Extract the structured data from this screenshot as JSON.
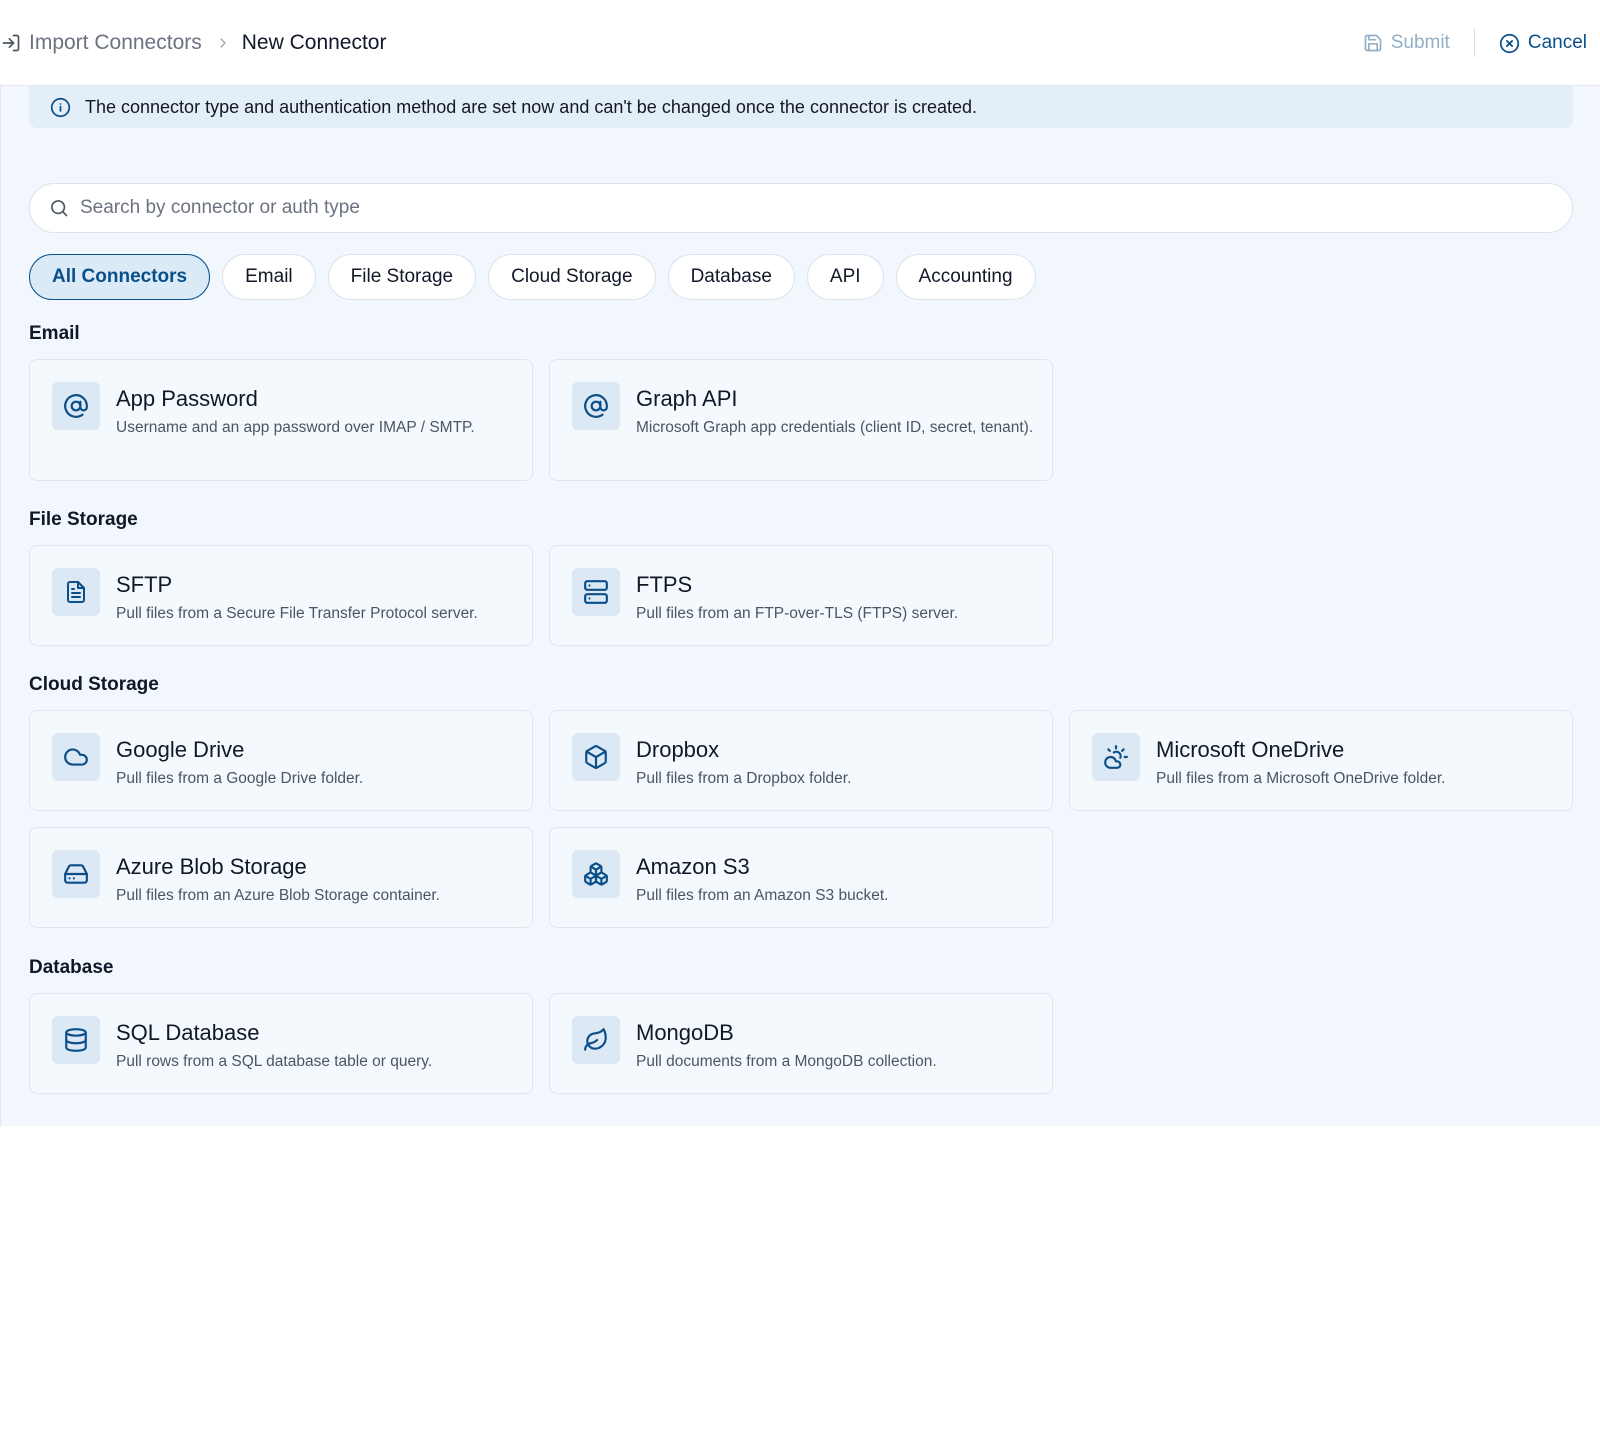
{
  "header": {
    "breadcrumb_parent": "Import Connectors",
    "breadcrumb_current": "New Connector",
    "submit_label": "Submit",
    "cancel_label": "Cancel"
  },
  "notice": {
    "text": "The connector type and authentication method are set now and can't be changed once the connector is created."
  },
  "search": {
    "placeholder": "Search by connector or auth type",
    "value": ""
  },
  "filters": {
    "active": "All Connectors",
    "items": [
      "All Connectors",
      "Email",
      "File Storage",
      "Cloud Storage",
      "Database",
      "API",
      "Accounting"
    ]
  },
  "sections": [
    {
      "title": "Email",
      "cards": [
        {
          "title": "App Password",
          "description": "Username and an app password over IMAP / SMTP.",
          "icon": "at-sign-icon"
        },
        {
          "title": "Graph API",
          "description": "Microsoft Graph app credentials (client ID, secret, tenant).",
          "icon": "at-sign-icon"
        }
      ]
    },
    {
      "title": "File Storage",
      "cards": [
        {
          "title": "SFTP",
          "description": "Pull files from a Secure File Transfer Protocol server.",
          "icon": "file-text-icon"
        },
        {
          "title": "FTPS",
          "description": "Pull files from an FTP-over-TLS (FTPS) server.",
          "icon": "server-icon"
        }
      ]
    },
    {
      "title": "Cloud Storage",
      "cards": [
        {
          "title": "Google Drive",
          "description": "Pull files from a Google Drive folder.",
          "icon": "cloud-icon"
        },
        {
          "title": "Dropbox",
          "description": "Pull files from a Dropbox folder.",
          "icon": "box-icon"
        },
        {
          "title": "Microsoft OneDrive",
          "description": "Pull files from a Microsoft OneDrive folder.",
          "icon": "cloud-sun-icon"
        },
        {
          "title": "Azure Blob Storage",
          "description": "Pull files from an Azure Blob Storage container.",
          "icon": "hard-drive-icon"
        },
        {
          "title": "Amazon S3",
          "description": "Pull files from an Amazon S3 bucket.",
          "icon": "boxes-icon"
        }
      ]
    },
    {
      "title": "Database",
      "cards": [
        {
          "title": "SQL Database",
          "description": "Pull rows from a SQL database table or query.",
          "icon": "database-icon"
        },
        {
          "title": "MongoDB",
          "description": "Pull documents from a MongoDB collection.",
          "icon": "leaf-icon"
        }
      ]
    }
  ],
  "colors": {
    "accent": "#0b4f8a",
    "page_background": "#f1f7fc",
    "notice_background": "#e4eef8",
    "icon_tile": "#dce8f3"
  }
}
